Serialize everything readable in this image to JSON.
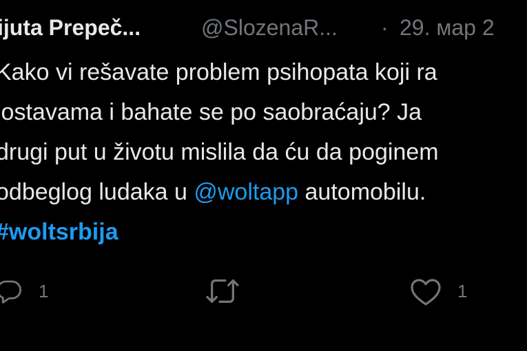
{
  "tweet": {
    "author_name": "ijuta Prepeč...",
    "handle": "@SlozenaR...",
    "separator": "·",
    "date": "29. мар 2",
    "text_lines": [
      {
        "text": "Kako vi rešavate problem psihopata koji ra"
      },
      {
        "text": "lostavama i bahate se po saobraćaju? Ja"
      },
      {
        "text": "drugi put u životu mislila da ću da poginem"
      },
      {
        "before": "odbeglog ludaka u ",
        "mention": "@woltapp",
        "after": " automobilu."
      },
      {
        "hashtag": "#woltsrbija"
      }
    ]
  },
  "actions": {
    "reply": {
      "icon": "reply-icon",
      "count": "1"
    },
    "retweet": {
      "icon": "retweet-icon"
    },
    "like": {
      "icon": "heart-icon",
      "count": "1"
    }
  },
  "colors": {
    "background": "#000000",
    "text": "#e7e9ea",
    "muted": "#71767b",
    "link": "#1d9bf0"
  }
}
